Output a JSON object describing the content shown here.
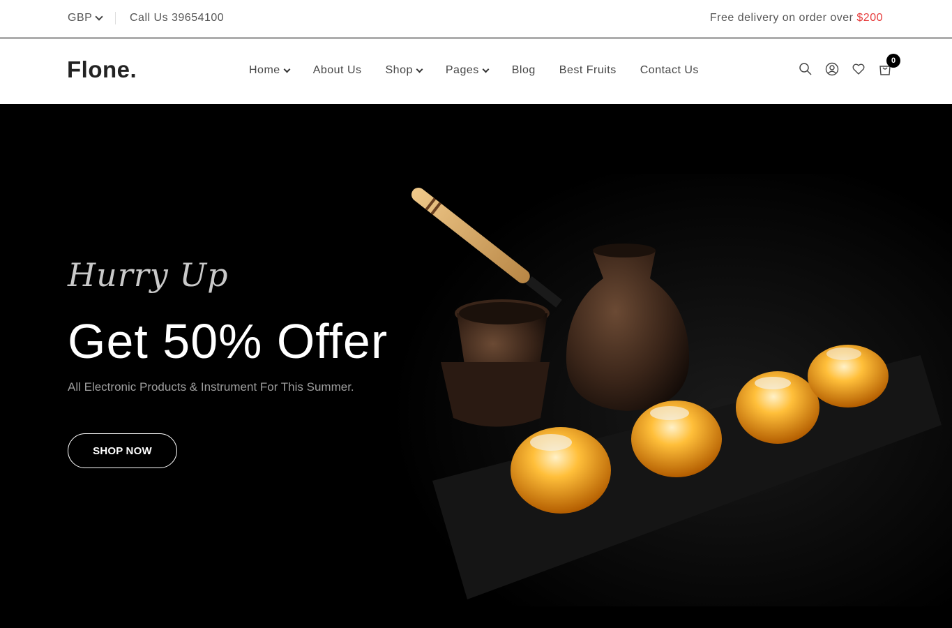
{
  "topbar": {
    "currency": "GBP",
    "call": "Call Us 39654100",
    "delivery_text": "Free delivery on order over ",
    "delivery_amount": "$200"
  },
  "header": {
    "logo": "Flone.",
    "nav": [
      {
        "label": "Home",
        "dropdown": true
      },
      {
        "label": "About Us",
        "dropdown": false
      },
      {
        "label": "Shop",
        "dropdown": true
      },
      {
        "label": "Pages",
        "dropdown": true
      },
      {
        "label": "Blog",
        "dropdown": false
      },
      {
        "label": "Best Fruits",
        "dropdown": false
      },
      {
        "label": "Contact Us",
        "dropdown": false
      }
    ],
    "icons": [
      "search-icon",
      "user-icon",
      "heart-icon",
      "cart-icon"
    ],
    "cart_count": "0"
  },
  "hero": {
    "kicker": "Hurry Up",
    "title": "Get 50% Offer",
    "subtitle": "All Electronic Products & Instrument For This Summer.",
    "button": "SHOP NOW"
  },
  "colors": {
    "accent": "#e63b3b",
    "hero_bg": "#000000"
  }
}
